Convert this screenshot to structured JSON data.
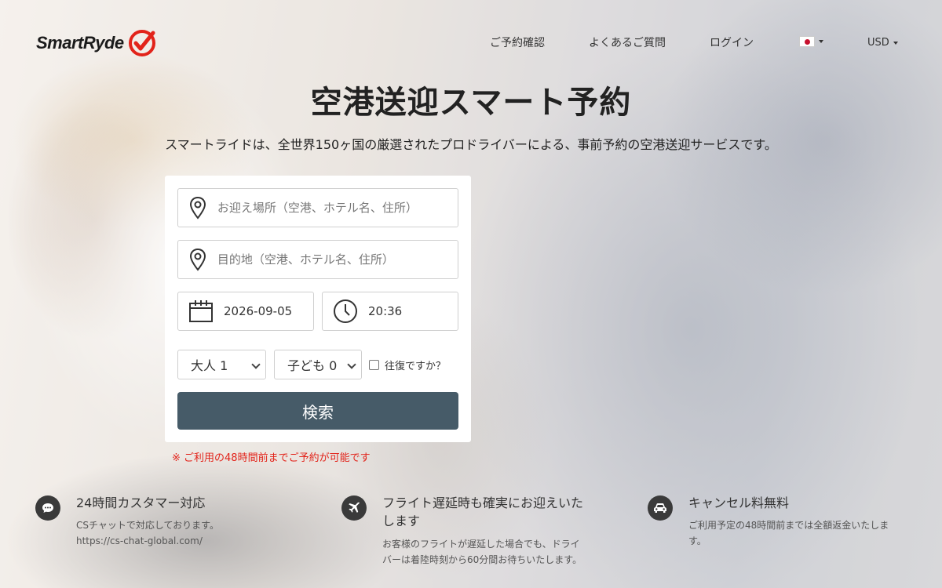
{
  "brand": {
    "name": "SmartRyde",
    "accent": "#e2231a"
  },
  "nav": {
    "booking_check": "ご予約確認",
    "faq": "よくあるご質問",
    "login": "ログイン",
    "language_icon": "japan-flag-icon",
    "currency": "USD"
  },
  "hero": {
    "title": "空港送迎スマート予約",
    "subtitle": "スマートライドは、全世界150ヶ国の厳選されたプロドライバーによる、事前予約の空港送迎サービスです。"
  },
  "form": {
    "pickup_placeholder": "お迎え場所（空港、ホテル名、住所）",
    "destination_placeholder": "目的地（空港、ホテル名、住所）",
    "date": "2026-09-05",
    "time": "20:36",
    "adults": "大人 1",
    "children": "子ども 0",
    "roundtrip_label": "往復ですか？",
    "roundtrip_checked": false,
    "search_label": "検索",
    "button_color": "#465b68",
    "notice": "※ ご利用の48時間前までご予約が可能です"
  },
  "features": [
    {
      "icon": "chat-bubble-icon",
      "title": "24時間カスタマー対応",
      "lines": [
        "CSチャットで対応しております。",
        "https://cs-chat-global.com/"
      ]
    },
    {
      "icon": "airplane-icon",
      "title_lines": [
        "フライト遅延時も確実にお迎えいた",
        "します"
      ],
      "lines": [
        "お客様のフライトが遅延した場合でも、ドライ",
        "バーは着陸時刻から60分間お待ちいたします。"
      ]
    },
    {
      "icon": "car-icon",
      "title": "キャンセル料無料",
      "lines": [
        "ご利用予定の48時間前までは全額返金いたしま",
        "す。"
      ]
    }
  ]
}
